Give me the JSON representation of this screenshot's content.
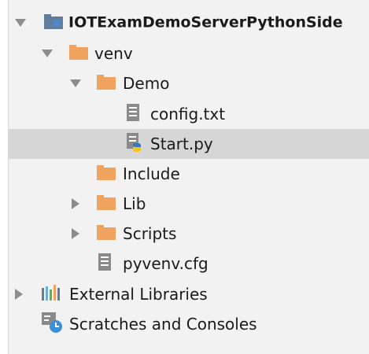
{
  "tree": {
    "root": {
      "label": "IOTExamDemoServerPythonSide"
    },
    "venv": {
      "label": "venv"
    },
    "demo": {
      "label": "Demo"
    },
    "config": {
      "label": "config.txt"
    },
    "start": {
      "label": "Start.py"
    },
    "include": {
      "label": "Include"
    },
    "lib": {
      "label": "Lib"
    },
    "scripts": {
      "label": "Scripts"
    },
    "pyvenv": {
      "label": "pyvenv.cfg"
    },
    "external": {
      "label": "External Libraries"
    },
    "scratches": {
      "label": "Scratches and Consoles"
    }
  },
  "icons": {
    "module_folder": "module-folder-icon",
    "folder": "folder-icon",
    "text_file": "text-file-icon",
    "python_file": "python-file-icon",
    "libraries": "libraries-icon",
    "scratches": "scratches-icon"
  },
  "colors": {
    "folder": "#f0a35e",
    "module_folder": "#607d9a",
    "selected_row": "#d6d6d6",
    "panel_bg": "#f2f2f2"
  },
  "selected_item": "Start.py"
}
